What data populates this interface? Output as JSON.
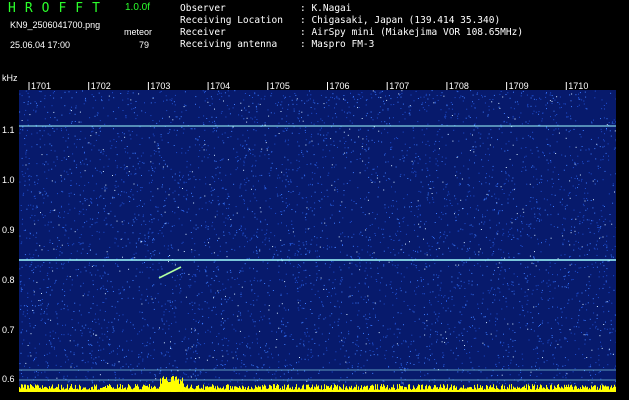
{
  "app": {
    "title": "HROFFT",
    "version": "1.0.0f",
    "filename": "KN9_2506041700.png",
    "datetime": "25.06.04 17:00",
    "meteor_label": "meteor",
    "meteor_count": "79"
  },
  "info": [
    {
      "key": "Observer",
      "value": ": K.Nagai"
    },
    {
      "key": "Receiving Location",
      "value": ": Chigasaki, Japan (139.414 35.340)"
    },
    {
      "key": "Receiver",
      "value": ": AirSpy mini (Miakejima VOR 108.65MHz)"
    },
    {
      "key": "Receiving antenna",
      "value": ": Maspro FM-3"
    }
  ],
  "axis": {
    "unit": "kHz",
    "y_ticks": [
      "1.1",
      "1.0",
      "0.9",
      "0.8",
      "0.7",
      "0.6"
    ],
    "x_ticks": [
      "1701",
      "1702",
      "1703",
      "1704",
      "1705",
      "1706",
      "1707",
      "1708",
      "1709",
      "1710"
    ]
  },
  "colors": {
    "background": "#071a6c",
    "noise": "#3c7cff",
    "carrier": "#a0ffff",
    "meteor": "#b0ffa0",
    "header_accent": "#2bff2b",
    "bottom_bar": "#ffff00"
  }
}
